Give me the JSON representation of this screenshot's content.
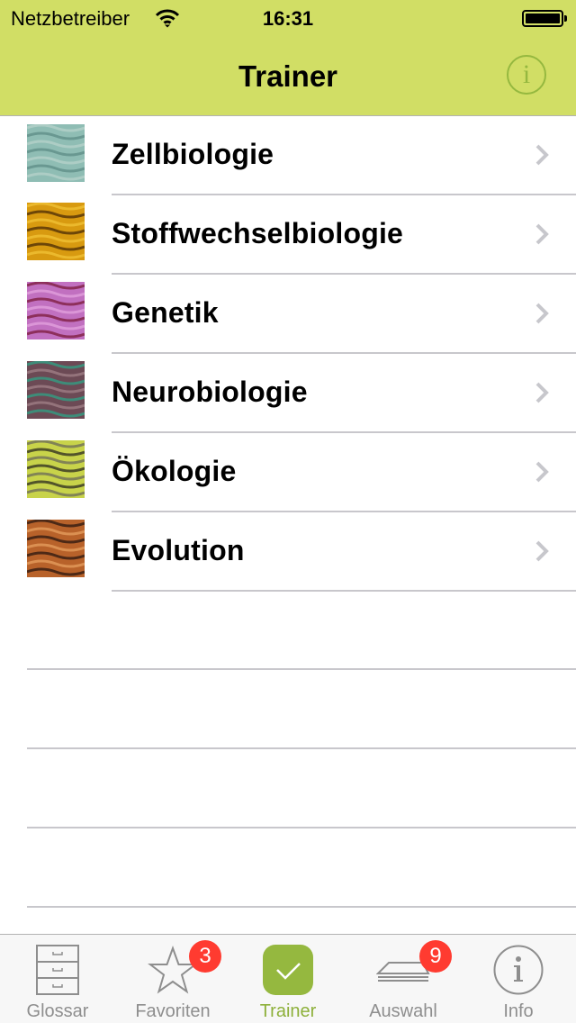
{
  "status_bar": {
    "carrier": "Netzbetreiber",
    "time": "16:31",
    "icons": [
      "wifi-icon",
      "battery-icon"
    ]
  },
  "nav": {
    "title": "Trainer",
    "info_glyph": "i",
    "info_icon": "info-circle-icon"
  },
  "topics": [
    {
      "label": "Zellbiologie",
      "thumb": "cell-biology-thumbnail",
      "colors": [
        "#8fbdb4",
        "#b7d3cb",
        "#5c8c85"
      ]
    },
    {
      "label": "Stoffwechselbiologie",
      "thumb": "metabolism-thumbnail",
      "colors": [
        "#d89a10",
        "#f2c337",
        "#4a2a05"
      ]
    },
    {
      "label": "Genetik",
      "thumb": "genetics-thumbnail",
      "colors": [
        "#c170c0",
        "#7b1a3a",
        "#e3a3df"
      ]
    },
    {
      "label": "Neurobiologie",
      "thumb": "neurobiology-thumbnail",
      "colors": [
        "#6c4a55",
        "#2fa385",
        "#a28188"
      ]
    },
    {
      "label": "Ökologie",
      "thumb": "ecology-thumbnail",
      "colors": [
        "#c8d34a",
        "#6b6a5a",
        "#2b2a20"
      ]
    },
    {
      "label": "Evolution",
      "thumb": "evolution-thumbnail",
      "colors": [
        "#b8622a",
        "#2a1710",
        "#e7a060"
      ]
    }
  ],
  "tabbar": {
    "tabs": [
      {
        "label": "Glossar",
        "icon": "filing-cabinet-icon",
        "active": false,
        "badge": null
      },
      {
        "label": "Favoriten",
        "icon": "star-icon",
        "active": false,
        "badge": "3"
      },
      {
        "label": "Trainer",
        "icon": "checkmark-icon",
        "active": true,
        "badge": null
      },
      {
        "label": "Auswahl",
        "icon": "card-stack-icon",
        "active": false,
        "badge": "9"
      },
      {
        "label": "Info",
        "icon": "info-circle-icon",
        "active": false,
        "badge": null
      }
    ]
  },
  "colors": {
    "header_bg": "#d1de65",
    "accent": "#8db03a",
    "info_icon": "#95b83f",
    "badge": "#ff3b30",
    "tab_inactive": "#8e8e8e",
    "separator": "#c8c7cc"
  }
}
